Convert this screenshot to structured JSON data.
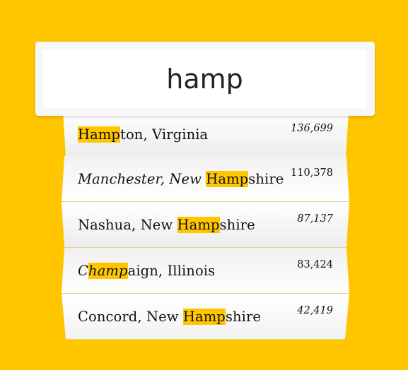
{
  "search": {
    "value": "hamp",
    "placeholder": ""
  },
  "suggestions": [
    {
      "prefix": "",
      "highlight": "Hamp",
      "suffix": "ton, Virginia",
      "population": "136,699"
    },
    {
      "prefix": "Manchester, New ",
      "highlight": "Hamp",
      "suffix": "shire",
      "population": "110,378"
    },
    {
      "prefix": "Nashua, New ",
      "highlight": "Hamp",
      "suffix": "shire",
      "population": "87,137"
    },
    {
      "prefix": "C",
      "highlight": "hamp",
      "suffix": "aign, Illinois",
      "population": "83,424"
    },
    {
      "prefix": "Concord, New ",
      "highlight": "Hamp",
      "suffix": "shire",
      "population": "42,419"
    }
  ],
  "colors": {
    "background": "#ffc600",
    "highlight": "#ffc600",
    "panel": "#f7f7f7"
  }
}
